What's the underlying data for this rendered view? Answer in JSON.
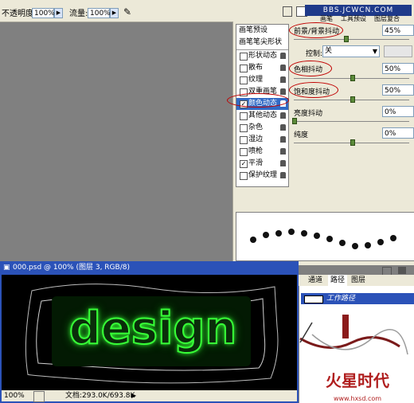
{
  "options": {
    "opacity_label": "不透明度:",
    "opacity_value": "100%",
    "flow_label": "流量:",
    "flow_value": "100%"
  },
  "tabstrip": {
    "site": "BBS.JCWCN.COM",
    "tab_brushes": "画笔",
    "tab_tools": "工具预设",
    "tab_layercomps": "图层复合"
  },
  "brush_panel": {
    "presets_label": "画笔预设",
    "tip_shape_label": "画笔笔尖形状",
    "items": [
      {
        "label": "形状动态",
        "checked": false
      },
      {
        "label": "散布",
        "checked": false
      },
      {
        "label": "纹理",
        "checked": false
      },
      {
        "label": "双重画笔",
        "checked": false
      },
      {
        "label": "颜色动态",
        "checked": true
      },
      {
        "label": "其他动态",
        "checked": false
      },
      {
        "label": "杂色",
        "checked": false
      },
      {
        "label": "湿边",
        "checked": false
      },
      {
        "label": "喷枪",
        "checked": false
      },
      {
        "label": "平滑",
        "checked": true
      },
      {
        "label": "保护纹理",
        "checked": false
      }
    ],
    "fg_bg_jitter_label": "前景/背景抖动",
    "fg_bg_jitter_value": "45%",
    "control_label": "控制:",
    "control_value": "关",
    "hue_jitter_label": "色相抖动",
    "hue_jitter_value": "50%",
    "saturation_jitter_label": "饱和度抖动",
    "saturation_jitter_value": "50%",
    "brightness_jitter_label": "亮度抖动",
    "brightness_jitter_value": "0%",
    "purity_label": "纯度",
    "purity_value": "0%"
  },
  "document": {
    "title": "000.psd @ 100% (图层 3, RGB/8)",
    "canvas_text": "design",
    "zoom": "100%",
    "doc_size": "文档:293.0K/693.8K"
  },
  "paths_panel": {
    "tab_channels": "通道",
    "tab_paths": "路径",
    "tab_layers": "图层",
    "work_path": "工作路径"
  },
  "watermark": {
    "brand": "火星时代",
    "url": "www.hxsd.com"
  },
  "colors": {
    "accent": "#2b52b8",
    "glow": "#37ff37",
    "annotation": "#c00000"
  }
}
